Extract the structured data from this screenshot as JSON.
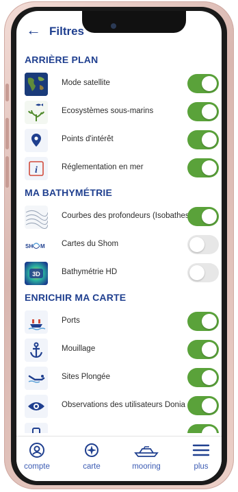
{
  "header": {
    "back_icon": "←",
    "title": "Filtres"
  },
  "sections": [
    {
      "title": "ARRIÈRE PLAN",
      "items": [
        {
          "label": "Mode satellite",
          "icon": "world-map-icon",
          "on": true
        },
        {
          "label": "Ecosystèmes sous-marins",
          "icon": "fish-coral-icon",
          "on": true
        },
        {
          "label": "Points d'intérêt",
          "icon": "map-pin-icon",
          "on": true
        },
        {
          "label": "Réglementation en mer",
          "icon": "info-icon",
          "on": true
        }
      ]
    },
    {
      "title": "MA BATHYMÉTRIE",
      "items": [
        {
          "label": "Courbes des profondeurs (Isobathes)",
          "icon": "contour-lines-icon",
          "on": true
        },
        {
          "label": "Cartes du Shom",
          "icon": "shom-logo-icon",
          "on": false
        },
        {
          "label": "Bathymétrie HD",
          "icon": "3d-bathymetry-icon",
          "on": false
        }
      ]
    },
    {
      "title": "ENRICHIR MA CARTE",
      "items": [
        {
          "label": "Ports",
          "icon": "boat-port-icon",
          "on": true
        },
        {
          "label": "Mouillage",
          "icon": "anchor-icon",
          "on": true
        },
        {
          "label": "Sites Plongée",
          "icon": "diver-icon",
          "on": true
        },
        {
          "label": "Observations des utilisateurs Donia",
          "icon": "eye-icon",
          "on": true
        },
        {
          "label": "",
          "icon": "more-icon",
          "on": true
        }
      ]
    }
  ],
  "bottom_nav": [
    {
      "label": "compte",
      "icon": "user-circle-icon"
    },
    {
      "label": "carte",
      "icon": "compass-icon"
    },
    {
      "label": "mooring",
      "icon": "yacht-icon"
    },
    {
      "label": "plus",
      "icon": "menu-icon"
    }
  ],
  "colors": {
    "primary": "#1f3f8f",
    "toggle_on": "#5aa23a",
    "toggle_off": "#e7e7e7"
  }
}
